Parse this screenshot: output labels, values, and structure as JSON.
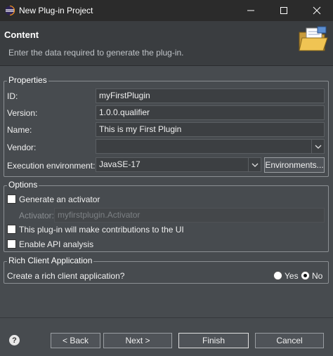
{
  "window": {
    "title": "New Plug-in Project",
    "icon": "eclipse-icon"
  },
  "header": {
    "title": "Content",
    "description": "Enter the data required to generate the plug-in.",
    "icon": "folder-open-icon"
  },
  "properties": {
    "legend": "Properties",
    "id_label": "ID:",
    "id_value": "myFirstPlugin",
    "version_label": "Version:",
    "version_value": "1.0.0.qualifier",
    "name_label": "Name:",
    "name_value": "This is my First Plugin",
    "vendor_label": "Vendor:",
    "vendor_value": "",
    "exec_env_label": "Execution environment:",
    "exec_env_value": "JavaSE-17",
    "environments_button": "Environments..."
  },
  "options": {
    "legend": "Options",
    "generate_activator_label": "Generate an activator",
    "generate_activator_checked": false,
    "activator_label": "Activator:",
    "activator_value": "myfirstplugin.Activator",
    "ui_contrib_label": "This plug-in will make contributions to the UI",
    "ui_contrib_checked": false,
    "api_analysis_label": "Enable API analysis",
    "api_analysis_checked": false
  },
  "rcp": {
    "legend": "Rich Client Application",
    "question": "Create a rich client application?",
    "yes_label": "Yes",
    "no_label": "No",
    "selected": "No"
  },
  "footer": {
    "back_label": "< Back",
    "next_label": "Next >",
    "finish_label": "Finish",
    "cancel_label": "Cancel"
  }
}
